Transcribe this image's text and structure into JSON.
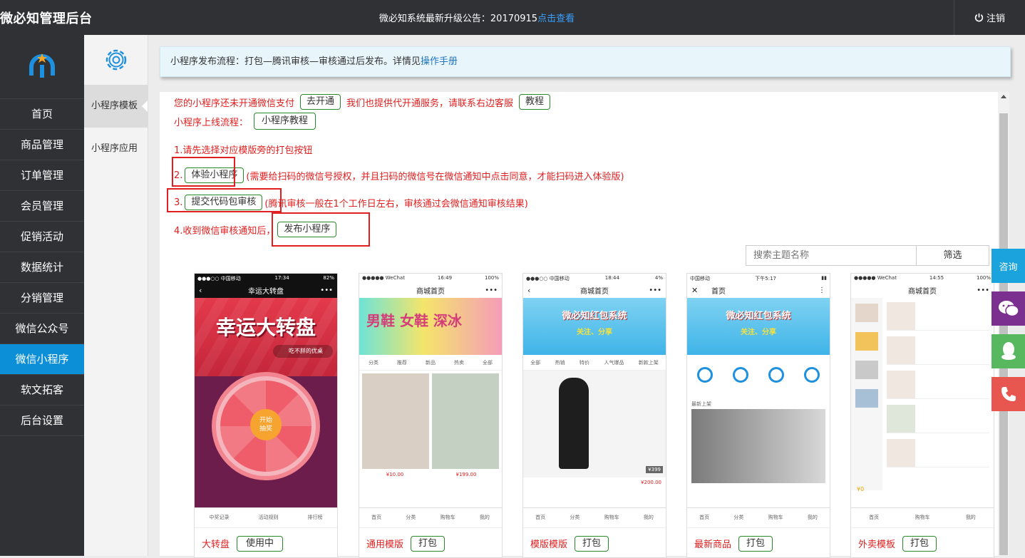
{
  "topbar": {
    "brand": "微必知管理后台",
    "notice_text": "微必知系统最新升级公告：20170915",
    "notice_link": "点击查看",
    "logout": "注销"
  },
  "sidenav": {
    "items": [
      "首页",
      "商品管理",
      "订单管理",
      "会员管理",
      "促销活动",
      "数据统计",
      "分销管理",
      "微信公众号",
      "微信小程序",
      "软文拓客",
      "后台设置"
    ],
    "active": "微信小程序"
  },
  "subnav": {
    "items": [
      "小程序模板",
      "小程序应用"
    ]
  },
  "banner": {
    "text": "小程序发布流程：打包—腾讯审核—审核通过后发布。详情见",
    "link": "操作手册"
  },
  "panel": {
    "pay_notice": "您的小程序还未开通微信支付",
    "open_btn": "去开通",
    "agent_notice": "我们也提供代开通服务，请联系右边客服",
    "tutorial_btn": "教程",
    "online_flow": "小程序上线流程：",
    "mp_tutorial_btn": "小程序教程",
    "step1": "1.请先选择对应模版旁的打包按钮",
    "step2_num": "2.",
    "step2_btn": "体验小程序",
    "step2_text": "(需要给扫码的微信号授权，并且扫码的微信号在微信通知中点击同意，才能扫码进入体验版)",
    "step3_num": "3.",
    "step3_btn": "提交代码包审核",
    "step3_text": "(腾讯审核一般在1个工作日左右，审核通过会微信通知审核结果)",
    "step4_text": "4.收到微信审核通知后，",
    "step4_btn": "发布小程序"
  },
  "search": {
    "placeholder": "搜索主题名称",
    "button": "筛选"
  },
  "cards": [
    {
      "name": "大转盘",
      "action": "使用中",
      "phone_title": "幸运大转盘",
      "tabs": [
        "中奖记录",
        "活动规则",
        "排行榜"
      ],
      "time": "17:34",
      "hero": "幸运大转盘"
    },
    {
      "name": "通用模版",
      "action": "打包",
      "phone_title": "商城首页",
      "tabs": [
        "首页",
        "分类",
        "购物车",
        "我的"
      ],
      "time": "16:49",
      "prices": [
        "¥10.00",
        "¥199.00"
      ]
    },
    {
      "name": "模版模版",
      "action": "打包",
      "phone_title": "商城首页",
      "tabs": [
        "首页",
        "分类",
        "购物车",
        "我的"
      ],
      "time": "18:44",
      "hero": "微必知红包系统",
      "price": "¥200.00"
    },
    {
      "name": "最新商品",
      "action": "打包",
      "phone_title": "首页",
      "tabs": [
        "首页",
        "分类",
        "购物车",
        "我的"
      ],
      "time": "下午5:17",
      "hero": "微必知红包系统",
      "tag": "最新上架"
    },
    {
      "name": "外卖模板",
      "action": "打包",
      "phone_title": "商城首页",
      "tabs": [
        "首页",
        "购物车",
        "我的"
      ],
      "time": "14:55",
      "price": "¥0"
    }
  ],
  "float_service": {
    "consult": "咨询"
  },
  "colors": {
    "topbar": "#2f3134",
    "active_nav": "#0d8fd8",
    "warning_red": "#e02020",
    "button_green": "#2a8a2a"
  }
}
